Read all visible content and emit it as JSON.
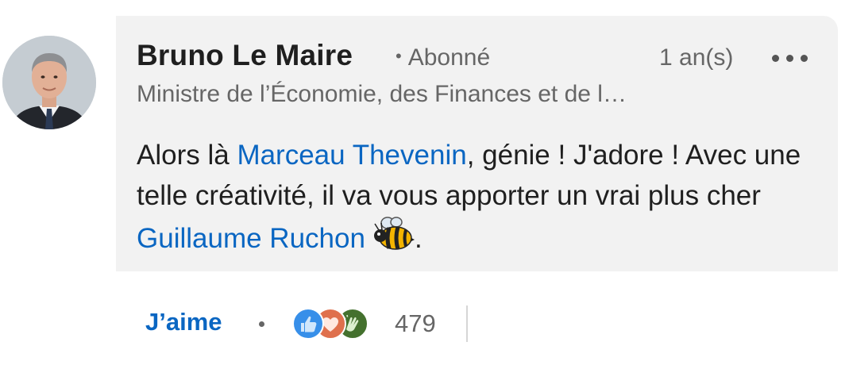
{
  "comment": {
    "author": {
      "name": "Bruno Le Maire",
      "degree": "Abonné",
      "headline": "Ministre de l’Économie, des Finances et de l…"
    },
    "timestamp": "1 an(s)",
    "more_icon": "ellipsis-icon",
    "text": {
      "part1": "Alors là ",
      "mention1": "Marceau Thevenin",
      "part2": ", génie ! J'adore ! Avec une telle créativité, il va vous apporter un vrai plus cher ",
      "mention2": "Guillaume Ruchon",
      "emoji": "bee-emoji",
      "part3": "."
    }
  },
  "actions": {
    "like_label": "J’aime",
    "reactions": [
      "like-icon",
      "love-icon",
      "celebrate-icon"
    ],
    "reaction_count": "479"
  },
  "colors": {
    "link": "#0a66c2",
    "bubble": "#f2f2f2",
    "secondary_text": "#666666",
    "primary_text": "#1f1f1f"
  }
}
